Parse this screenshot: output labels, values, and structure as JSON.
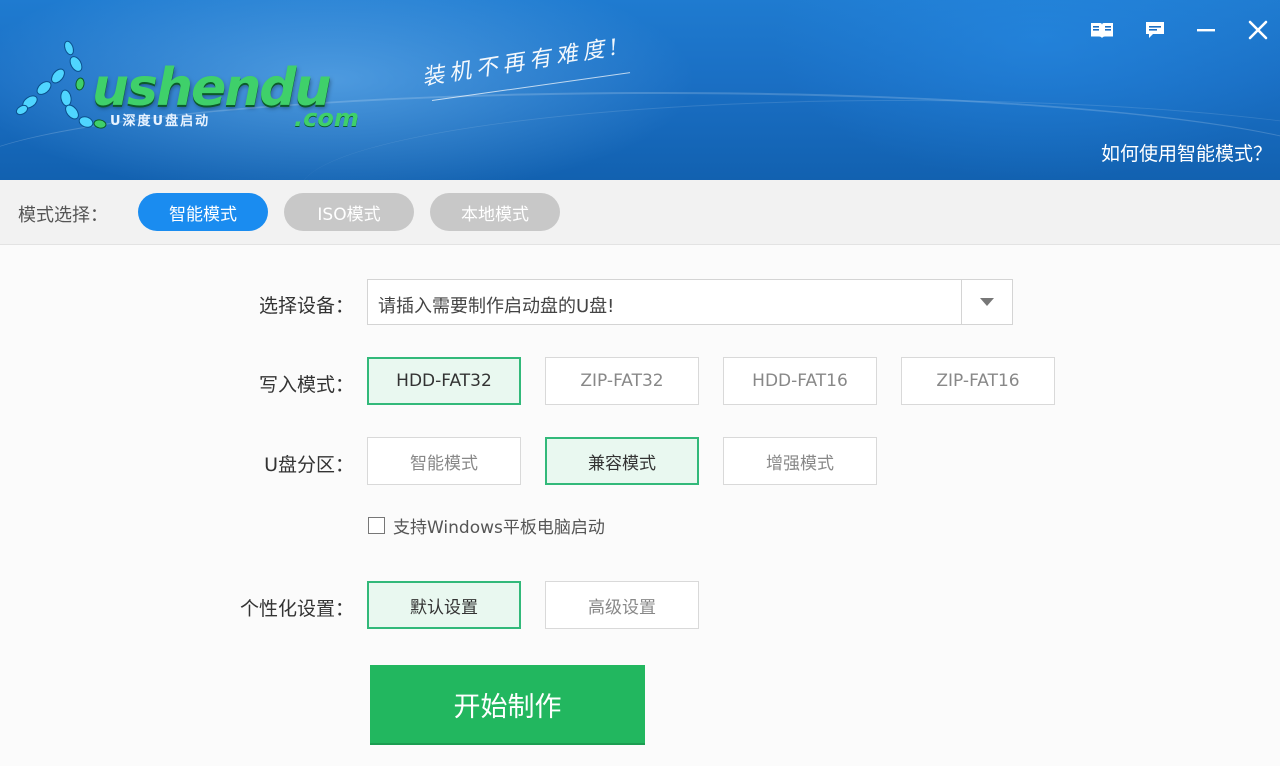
{
  "header": {
    "logo_text": "ushendu",
    "logo_subtitle": "U深度U盘启动",
    "logo_domain": ".com",
    "slogan": "装机不再有难度!",
    "help_link": "如何使用智能模式？",
    "window_buttons": [
      "book-icon",
      "feedback-icon",
      "minimize-icon",
      "close-icon"
    ]
  },
  "mode_bar": {
    "label": "模式选择：",
    "modes": [
      {
        "label": "智能模式",
        "active": true
      },
      {
        "label": "ISO模式",
        "active": false
      },
      {
        "label": "本地模式",
        "active": false
      }
    ]
  },
  "form": {
    "device": {
      "label": "选择设备：",
      "value": "请插入需要制作启动盘的U盘!"
    },
    "write_mode": {
      "label": "写入模式：",
      "options": [
        "HDD-FAT32",
        "ZIP-FAT32",
        "HDD-FAT16",
        "ZIP-FAT16"
      ],
      "selected": "HDD-FAT32"
    },
    "partition": {
      "label": "U盘分区：",
      "options": [
        "智能模式",
        "兼容模式",
        "增强模式"
      ],
      "selected": "兼容模式"
    },
    "tablet_boot": {
      "label": "支持Windows平板电脑启动",
      "checked": false
    },
    "personalize": {
      "label": "个性化设置：",
      "options": [
        "默认设置",
        "高级设置"
      ],
      "selected": "默认设置"
    },
    "start_button": "开始制作"
  },
  "colors": {
    "header_blue": "#1a6fc4",
    "accent_blue": "#1a8cf0",
    "accent_green": "#22b75f",
    "selected_border": "#32b97a"
  }
}
